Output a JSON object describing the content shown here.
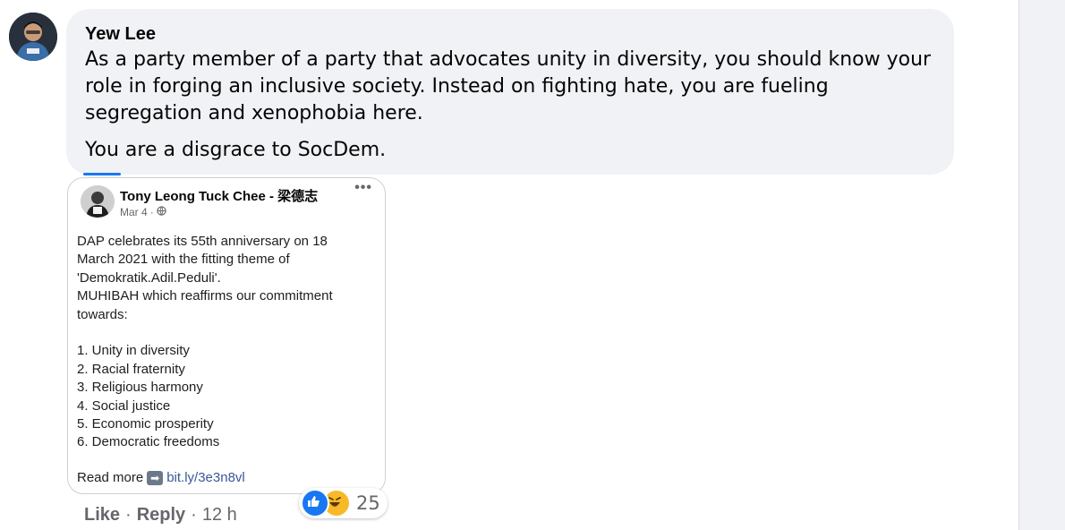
{
  "comment": {
    "author": "Yew Lee",
    "paragraphs": [
      "As a party member of a party that advocates unity in diversity, you should know your role in forging an inclusive society. Instead on fighting hate, you are fueling segregation and xenophobia here.",
      "You are a disgrace to SocDem."
    ]
  },
  "shared_post": {
    "poster_name": "Tony Leong Tuck Chee - 梁德志",
    "date": "Mar 4",
    "separator": "·",
    "privacy_icon": "globe-icon",
    "body_lines": [
      "DAP celebrates its 55th anniversary on 18",
      "March 2021 with the fitting theme of",
      "'Demokratik.Adil.Peduli'.",
      "MUHIBAH which reaffirms our commitment",
      "towards:",
      "",
      "1. Unity in diversity",
      "2. Racial fraternity",
      "3. Religious harmony",
      "4. Social justice",
      "5. Economic prosperity",
      "6. Democratic freedoms",
      ""
    ],
    "read_more": "Read more",
    "arrow_icon": "right-arrow-icon",
    "link_text": "bit.ly/3e3n8vl"
  },
  "actions": {
    "like": "Like",
    "dot1": "·",
    "reply": "Reply",
    "dot2": "·",
    "time": "12 h"
  },
  "reactions": {
    "count": "25",
    "types": [
      "like-icon",
      "haha-icon"
    ]
  },
  "colors": {
    "bubble": "#f0f2f5",
    "accent": "#1877f2",
    "muted": "#65676b",
    "link": "#385898"
  }
}
